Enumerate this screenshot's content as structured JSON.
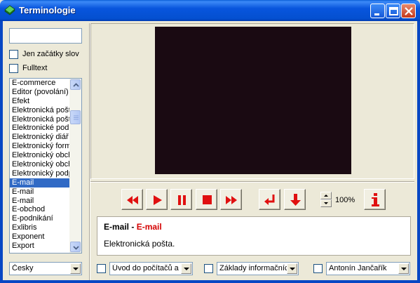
{
  "window": {
    "title": "Terminologie"
  },
  "search": {
    "value": "",
    "placeholder": ""
  },
  "options": {
    "word_start_label": "Jen začátky slov",
    "fulltext_label": "Fulltext"
  },
  "term_list": {
    "items": [
      "E-commerce",
      "Editor (povolání)",
      "Efekt",
      "Elektronická pošta",
      "Elektronická pošta",
      "Elektronické podpisy",
      "Elektronický diář",
      "Elektronický formulář",
      "Elektronický obchod",
      "Elektronický obchod",
      "Elektronický podpis",
      "E-mail",
      "E-mail",
      "E-mail",
      "E-obchod",
      "E-podnikání",
      "Exlibris",
      "Exponent",
      "Export"
    ],
    "selected_index": 11
  },
  "language": {
    "selected": "Česky"
  },
  "player": {
    "zoom": "100%",
    "buttons": [
      "rewind-icon",
      "play-icon",
      "pause-icon",
      "stop-icon",
      "fast-forward-icon",
      "return-icon",
      "down-arrow-icon",
      "info-icon"
    ]
  },
  "term": {
    "name": "E-mail",
    "separator": " - ",
    "translation": "E-mail",
    "description": "Elektronická pošta."
  },
  "filters": {
    "course": "Úvod do počítačů a",
    "topic": "Základy informačníc",
    "author": "Antonín Jančařík"
  },
  "colors": {
    "title_bar": "#0855dd",
    "selection": "#316ac5",
    "accent_red": "#d40000",
    "video_bg": "#1a0a12"
  }
}
